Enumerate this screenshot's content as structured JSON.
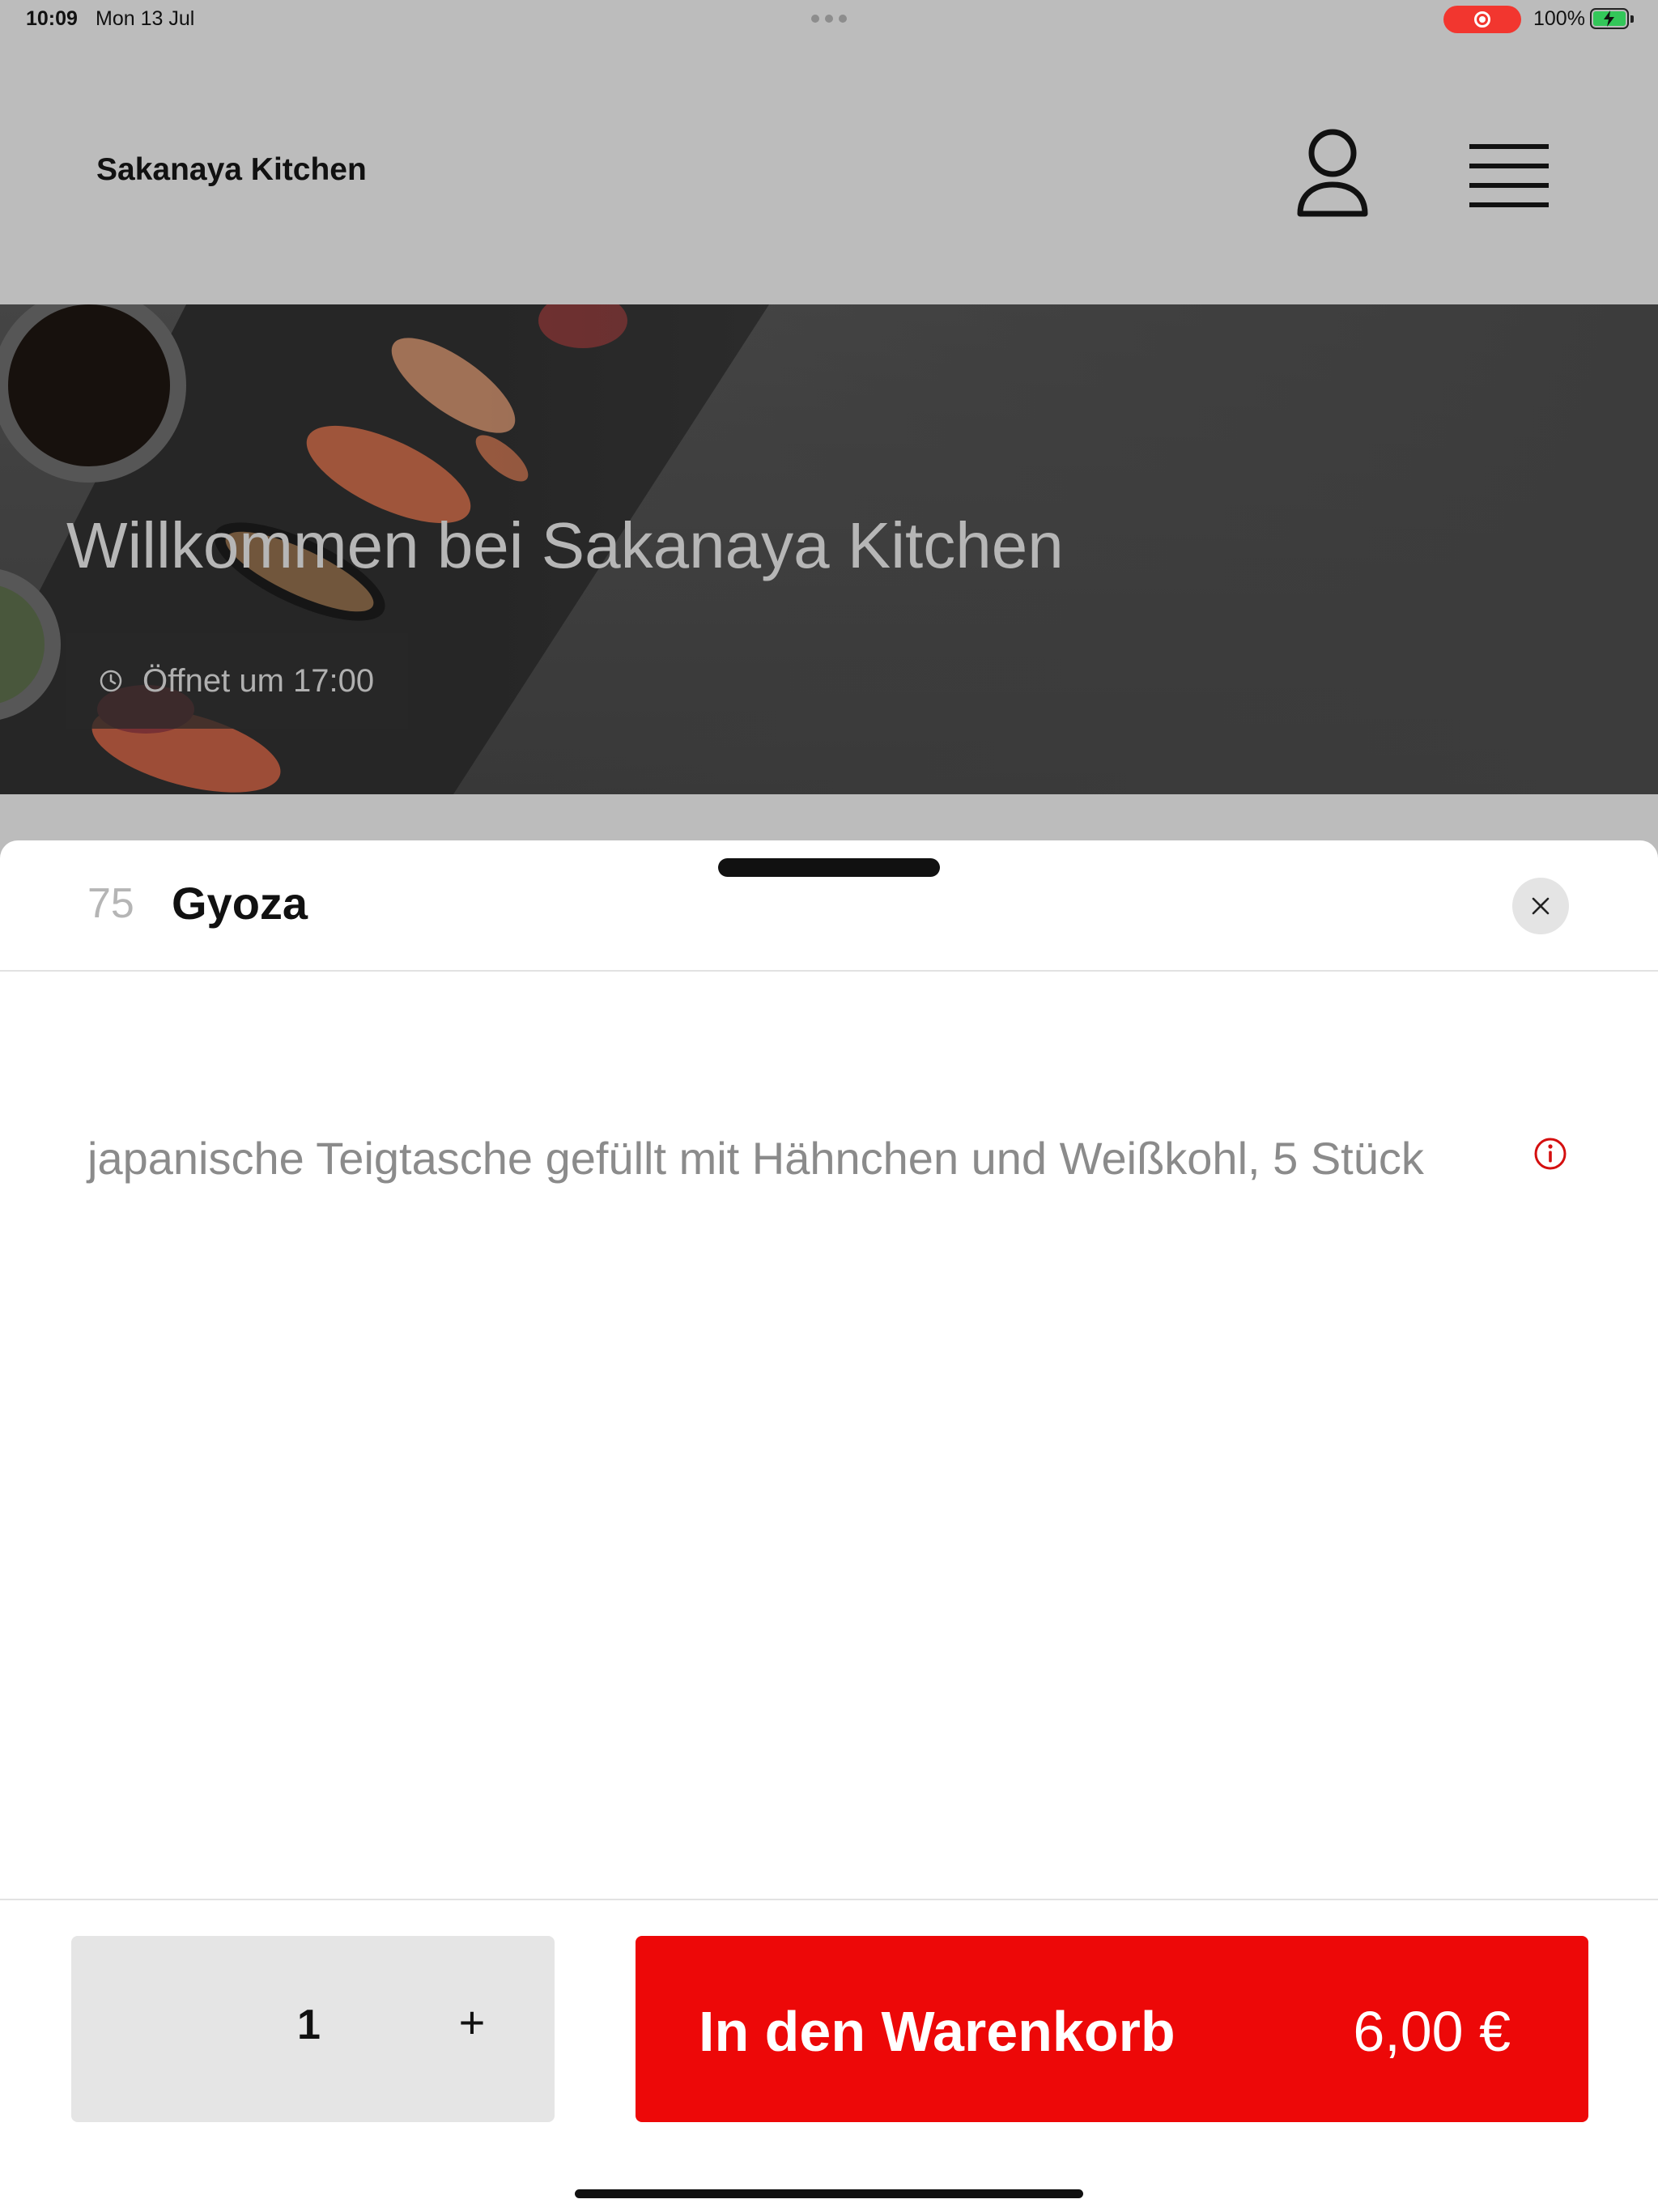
{
  "status_bar": {
    "time": "10:09",
    "date": "Mon 13 Jul",
    "battery_percent": "100%",
    "battery_level": 1.0,
    "recording_icon": "screen-record-icon",
    "battery_icon": "battery-charging-icon"
  },
  "header": {
    "brand": "Sakanaya Kitchen",
    "profile_icon": "user-icon",
    "menu_icon": "hamburger-menu-icon"
  },
  "hero": {
    "title": "Willkommen bei Sakanaya Kitchen",
    "hours_icon": "clock-icon",
    "hours": "Öffnet um 17:00"
  },
  "sheet": {
    "item_number": "75",
    "item_name": "Gyoza",
    "close_icon": "close-icon",
    "description": "japanische Teigtasche gefüllt mit Hähnchen und Weißkohl, 5 Stück",
    "info_icon": "info-icon"
  },
  "footer": {
    "quantity": "1",
    "plus_label": "+",
    "add_to_cart_label": "In den Warenkorb",
    "price": "6,00 €"
  },
  "colors": {
    "accent": "#ed0808",
    "header_bg": "#bcbcbc",
    "sheet_bg": "#ffffff",
    "muted_text": "#8b8b8b"
  }
}
